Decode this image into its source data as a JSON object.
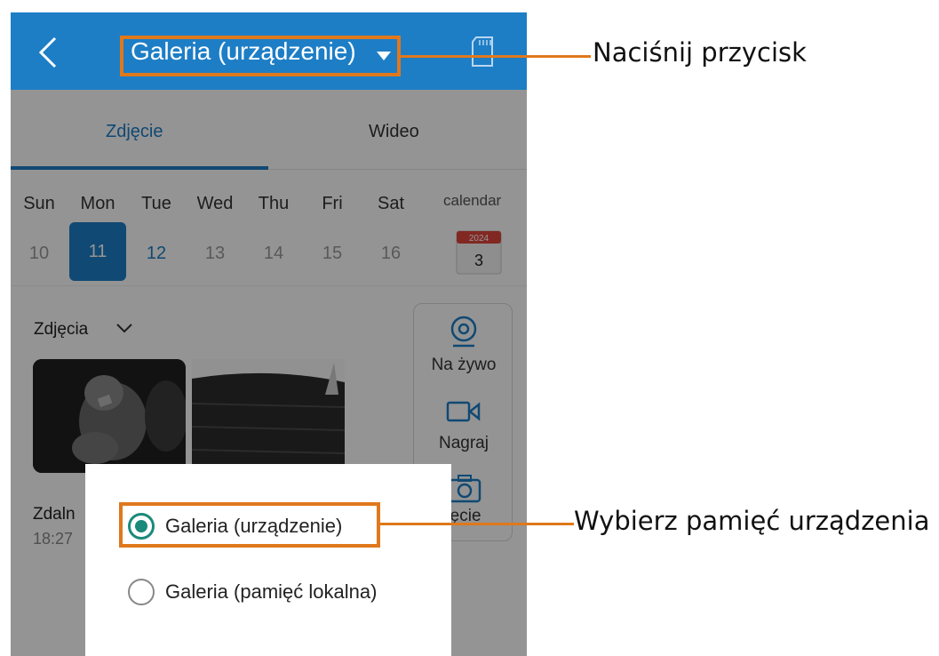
{
  "header": {
    "title": "Galeria (urządzenie)"
  },
  "tabs": [
    {
      "label": "Zdjęcie"
    },
    {
      "label": "Wideo"
    }
  ],
  "week": {
    "days": [
      {
        "name": "Sun",
        "num": "10"
      },
      {
        "name": "Mon",
        "num": "11"
      },
      {
        "name": "Tue",
        "num": "12"
      },
      {
        "name": "Wed",
        "num": "13"
      },
      {
        "name": "Thu",
        "num": "14"
      },
      {
        "name": "Fri",
        "num": "15"
      },
      {
        "name": "Sat",
        "num": "16"
      }
    ],
    "calendar_label": "calendar",
    "calendar_year": "2024",
    "calendar_day": "3"
  },
  "photos": {
    "filter_label": "Zdjęcia"
  },
  "recording": {
    "name": "Zdaln",
    "time": "18:27"
  },
  "actions": [
    {
      "label": "Na żywo",
      "icon": "webcam-icon"
    },
    {
      "label": "Nagraj",
      "icon": "video-camera-icon"
    },
    {
      "label": "jęcie",
      "icon": "camera-icon"
    }
  ],
  "popup": {
    "options": [
      {
        "label": "Galeria (urządzenie)",
        "selected": true
      },
      {
        "label": "Galeria (pamięć lokalna)",
        "selected": false
      }
    ]
  },
  "annotations": {
    "press_button": "Naciśnij przycisk",
    "choose_memory": "Wybierz pamięć urządzenia"
  },
  "colors": {
    "accent": "#1d7ec6",
    "highlight": "#e0781c",
    "radio": "#1a8a7a"
  }
}
